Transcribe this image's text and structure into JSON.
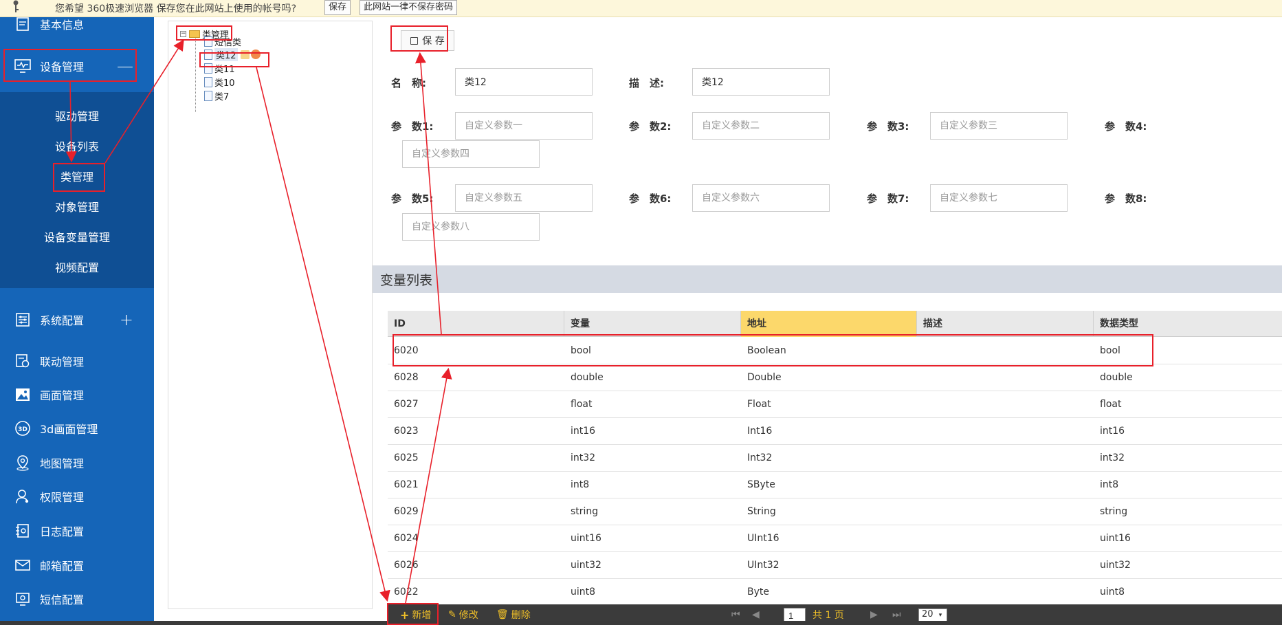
{
  "browser_bar": {
    "message": "您希望 360极速浏览器 保存您在此网站上使用的帐号吗?",
    "save_label": "保存",
    "never_label": "此网站一律不保存密码"
  },
  "sidebar": {
    "top_item": "基本信息",
    "device_mgmt": "设备管理",
    "device_sign": "—",
    "sub_items": [
      "驱动管理",
      "设备列表",
      "类管理",
      "对象管理",
      "设备变量管理",
      "视频配置"
    ],
    "system_cfg": "系统配置",
    "system_sign": "+",
    "items": [
      "联动管理",
      "画面管理",
      "3d画面管理",
      "地图管理",
      "权限管理",
      "日志配置",
      "邮箱配置",
      "短信配置"
    ]
  },
  "tree": {
    "root": "类管理",
    "children": [
      "短信类",
      "类12",
      "类11",
      "类10",
      "类7"
    ]
  },
  "form": {
    "save_label": "保 存",
    "name_label": "名　称:",
    "name_value": "类12",
    "desc_label": "描　述:",
    "desc_value": "类12",
    "params": [
      {
        "label": "参　数1:",
        "placeholder": "自定义参数一"
      },
      {
        "label": "参　数2:",
        "placeholder": "自定义参数二"
      },
      {
        "label": "参　数3:",
        "placeholder": "自定义参数三"
      },
      {
        "label": "参　数4:",
        "placeholder": "自定义参数四"
      },
      {
        "label": "参　数5:",
        "placeholder": "自定义参数五"
      },
      {
        "label": "参　数6:",
        "placeholder": "自定义参数六"
      },
      {
        "label": "参　数7:",
        "placeholder": "自定义参数七"
      },
      {
        "label": "参　数8:",
        "placeholder": "自定义参数八"
      }
    ]
  },
  "var_list": {
    "title": "变量列表",
    "columns": [
      "ID",
      "变量",
      "地址",
      "描述",
      "数据类型"
    ],
    "rows": [
      [
        "6020",
        "bool",
        "Boolean",
        "",
        "bool"
      ],
      [
        "6028",
        "double",
        "Double",
        "",
        "double"
      ],
      [
        "6027",
        "float",
        "Float",
        "",
        "float"
      ],
      [
        "6023",
        "int16",
        "Int16",
        "",
        "int16"
      ],
      [
        "6025",
        "int32",
        "Int32",
        "",
        "int32"
      ],
      [
        "6021",
        "int8",
        "SByte",
        "",
        "int8"
      ],
      [
        "6029",
        "string",
        "String",
        "",
        "string"
      ],
      [
        "6024",
        "uint16",
        "UInt16",
        "",
        "uint16"
      ],
      [
        "6026",
        "uint32",
        "UInt32",
        "",
        "uint32"
      ],
      [
        "6022",
        "uint8",
        "Byte",
        "",
        "uint8"
      ]
    ]
  },
  "footer": {
    "add_label": "新增",
    "edit_label": "修改",
    "delete_label": "删除",
    "page_value": "1",
    "total_pages": "共 1 页",
    "page_size": "20"
  },
  "colors": {
    "sidebar": "#1565b8",
    "submenu": "#0f4f94",
    "highlight_column": "#fcd86b",
    "annotation": "#e8202a",
    "footer_text": "#f0c028"
  }
}
